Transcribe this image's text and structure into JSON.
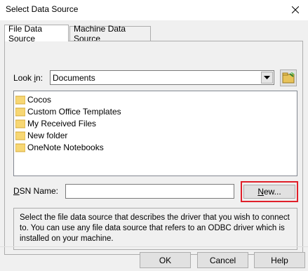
{
  "window": {
    "title": "Select Data Source"
  },
  "tabs": [
    {
      "label": "File Data Source",
      "active": true
    },
    {
      "label": "Machine Data Source",
      "active": false
    }
  ],
  "lookin": {
    "label_prefix": "Look ",
    "label_access": "i",
    "label_suffix": "n:",
    "value": "Documents"
  },
  "folders": [
    {
      "label": "Cocos"
    },
    {
      "label": "Custom Office Templates"
    },
    {
      "label": "My Received Files"
    },
    {
      "label": "New folder"
    },
    {
      "label": "OneNote Notebooks"
    }
  ],
  "dsn": {
    "label_access": "D",
    "label_rest": "SN Name:",
    "value": "",
    "new_access": "N",
    "new_rest": "ew..."
  },
  "description": "Select the file data source that describes the driver that you wish to connect to. You can use any file data source that refers to an ODBC driver which is installed on your machine.",
  "buttons": {
    "ok": "OK",
    "cancel": "Cancel",
    "help": "Help"
  },
  "colors": {
    "highlight_border": "#e0202a",
    "folder_yellow": "#f7d774"
  }
}
